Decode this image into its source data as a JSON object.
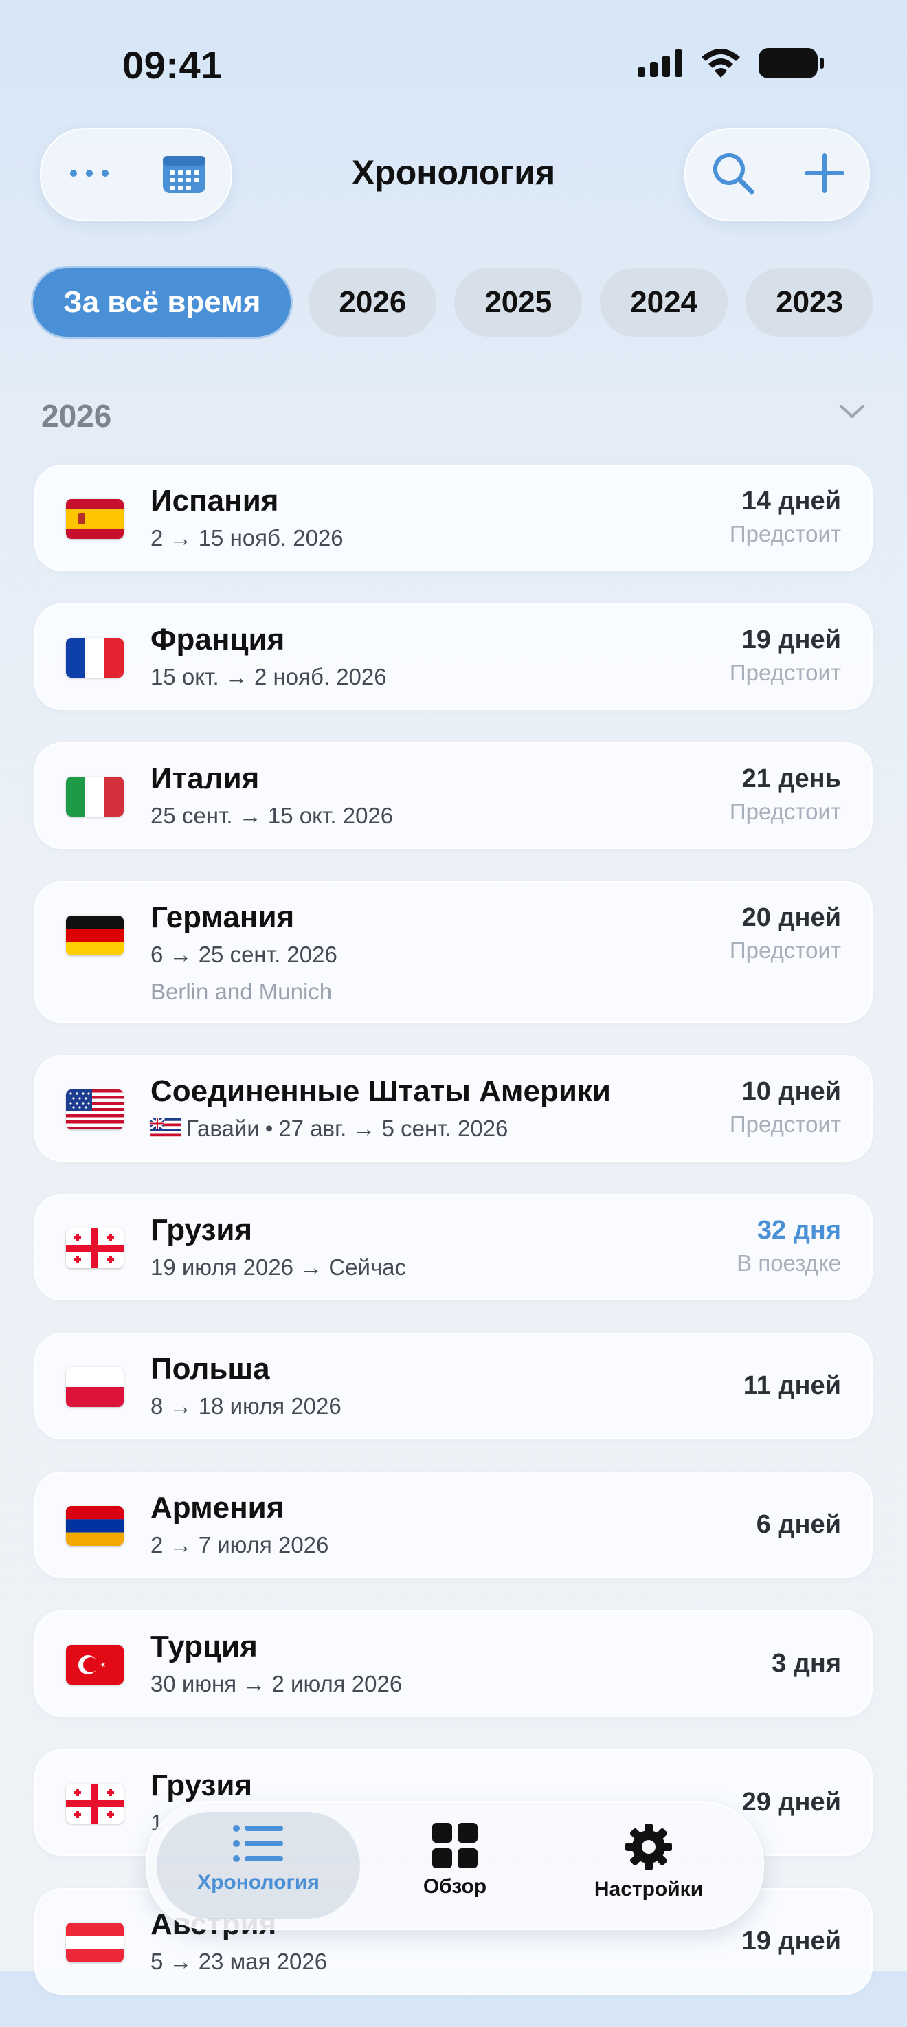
{
  "status_bar": {
    "time": "09:41"
  },
  "header": {
    "title": "Хронология",
    "left_icons": [
      "more-icon",
      "calendar-icon"
    ],
    "right_icons": [
      "search-icon",
      "plus-icon"
    ]
  },
  "colors": {
    "accent": "#4a90d6",
    "chip_bg": "#d7dfe9",
    "muted": "#a7afba"
  },
  "filters": [
    {
      "label": "За всё время",
      "selected": true
    },
    {
      "label": "2026",
      "selected": false
    },
    {
      "label": "2025",
      "selected": false
    },
    {
      "label": "2024",
      "selected": false
    },
    {
      "label": "2023",
      "selected": false
    }
  ],
  "section": {
    "year": "2026"
  },
  "trips": [
    {
      "country": "Испания",
      "dates": "2 → 15 нояб. 2026",
      "duration": "14 дней",
      "status": "Предстоит",
      "flag": "spain"
    },
    {
      "country": "Франция",
      "dates": "15 окт. → 2 нояб. 2026",
      "duration": "19 дней",
      "status": "Предстоит",
      "flag": "france"
    },
    {
      "country": "Италия",
      "dates": "25 сент. → 15 окт. 2026",
      "duration": "21 день",
      "status": "Предстоит",
      "flag": "italy"
    },
    {
      "country": "Германия",
      "dates": "6 → 25 сент. 2026",
      "note": "Berlin and Munich",
      "duration": "20 дней",
      "status": "Предстоит",
      "flag": "germany"
    },
    {
      "country": "Соединенные Штаты Америки",
      "region": "Гавайи",
      "dates": "27 авг. → 5 сент. 2026",
      "duration": "10 дней",
      "status": "Предстоит",
      "flag": "usa",
      "region_flag": "hawaii"
    },
    {
      "country": "Грузия",
      "dates": "19 июля 2026 → Сейчас",
      "duration": "32 дня",
      "status": "В поездке",
      "flag": "georgia"
    },
    {
      "country": "Польша",
      "dates": "8 → 18 июля 2026",
      "duration": "11 дней",
      "flag": "poland"
    },
    {
      "country": "Армения",
      "dates": "2 → 7 июля 2026",
      "duration": "6 дней",
      "flag": "armenia"
    },
    {
      "country": "Турция",
      "dates": "30 июня → 2 июля 2026",
      "duration": "3 дня",
      "flag": "turkey"
    },
    {
      "country": "Грузия",
      "dates": "1",
      "duration": "29 дней",
      "flag": "georgia"
    },
    {
      "country": "Австрия",
      "dates": "5 → 23 мая 2026",
      "duration": "19 дней",
      "flag": "austria"
    }
  ],
  "tabbar": {
    "tabs": [
      {
        "label": "Хронология",
        "icon": "list-icon",
        "active": true
      },
      {
        "label": "Обзор",
        "icon": "grid-icon",
        "active": false
      },
      {
        "label": "Настройки",
        "icon": "gear-icon",
        "active": false
      }
    ]
  }
}
